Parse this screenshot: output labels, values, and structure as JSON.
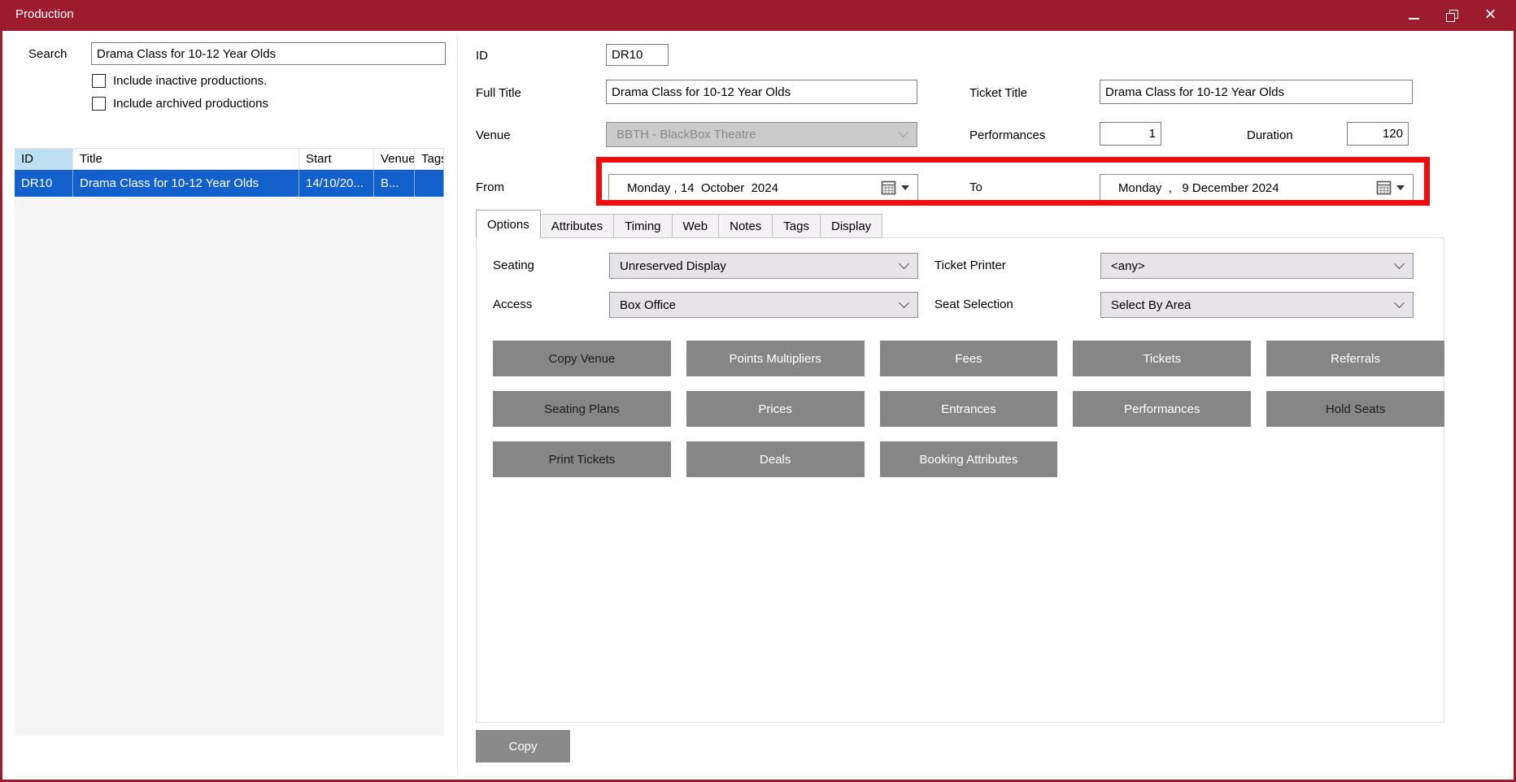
{
  "window": {
    "title": "Production",
    "controls": {
      "minimize": "minimize",
      "restore": "restore-down",
      "close": "close"
    }
  },
  "colors": {
    "titlebar_red": "#9C1B2C",
    "annotation_red": "#F20D0D",
    "selection_blue": "#1260CB",
    "sorted_column_blue": "#BFE0F3",
    "button_gray": "#868686"
  },
  "search_panel": {
    "search_label": "Search",
    "search_value": "Drama Class for 10-12 Year Olds",
    "include_inactive_label": "Include inactive productions.",
    "include_archived_label": "Include archived productions",
    "table": {
      "columns": [
        "ID",
        "Title",
        "Start",
        "Venue",
        "Tags"
      ],
      "selected_row": {
        "id": "DR10",
        "title": "Drama Class for 10-12 Year Olds",
        "start": "14/10/20...",
        "venue": "B...",
        "tags": ""
      }
    }
  },
  "form": {
    "id_label": "ID",
    "id_value": "DR10",
    "full_title_label": "Full Title",
    "full_title_value": "Drama Class for 10-12 Year Olds",
    "ticket_title_label": "Ticket Title",
    "ticket_title_value": "Drama Class for 10-12 Year Olds",
    "venue_label": "Venue",
    "venue_value": "BBTH - BlackBox Theatre",
    "performances_label": "Performances",
    "performances_value": "1",
    "duration_label": "Duration",
    "duration_value": "120",
    "from_label": "From",
    "from_value": "Monday , 14  October  2024",
    "to_label": "To",
    "to_value": "Monday  ,   9 December 2024"
  },
  "tabs": {
    "active": "Options",
    "items": [
      {
        "label": "Options"
      },
      {
        "label": "Attributes"
      },
      {
        "label": "Timing"
      },
      {
        "label": "Web"
      },
      {
        "label": "Notes"
      },
      {
        "label": "Tags"
      },
      {
        "label": "Display"
      }
    ]
  },
  "options_tab": {
    "seating_label": "Seating",
    "seating_value": "Unreserved Display",
    "ticket_printer_label": "Ticket Printer",
    "ticket_printer_value": "<any>",
    "access_label": "Access",
    "access_value": "Box Office",
    "seat_selection_label": "Seat Selection",
    "seat_selection_value": "Select By Area",
    "buttons": [
      {
        "label": "Copy Venue"
      },
      {
        "label": "Points Multipliers"
      },
      {
        "label": "Fees"
      },
      {
        "label": "Tickets"
      },
      {
        "label": "Referrals"
      },
      {
        "label": "Seating Plans"
      },
      {
        "label": "Prices"
      },
      {
        "label": "Entrances"
      },
      {
        "label": "Performances"
      },
      {
        "label": "Hold Seats"
      },
      {
        "label": "Print Tickets"
      },
      {
        "label": "Deals"
      },
      {
        "label": "Booking Attributes"
      }
    ]
  },
  "footer": {
    "copy_label": "Copy"
  }
}
